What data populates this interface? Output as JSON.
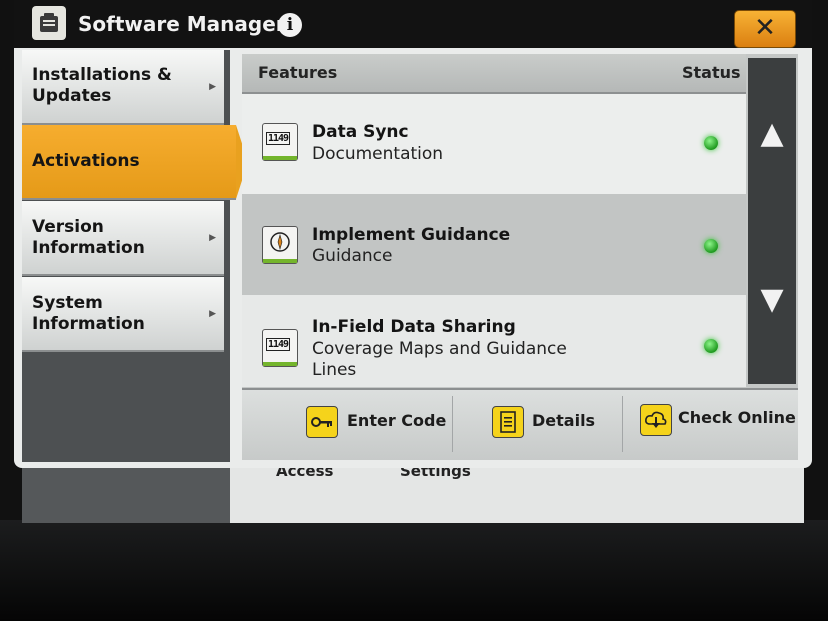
{
  "window": {
    "title": "Software Manager"
  },
  "sidebar": {
    "items": [
      {
        "label": "Installations & Updates",
        "active": false
      },
      {
        "label": "Activations",
        "active": true
      },
      {
        "label": "Version Information",
        "active": false
      },
      {
        "label": "System Information",
        "active": false
      }
    ]
  },
  "table": {
    "header_features": "Features",
    "header_status": "Status",
    "rows": [
      {
        "name": "Data Sync",
        "sub": "Documentation",
        "icon_text": "1149",
        "status": "active"
      },
      {
        "name": "Implement Guidance",
        "sub": "Guidance",
        "icon_text": "",
        "status": "active"
      },
      {
        "name": "In-Field Data Sharing",
        "sub": "Coverage Maps and Guidance Lines",
        "icon_text": "1149",
        "status": "active"
      }
    ]
  },
  "footer": {
    "enter_code": "Enter Code",
    "details": "Details",
    "check_online": "Check Online"
  },
  "background_screen": {
    "label_left": "Access",
    "label_right": "Settings"
  },
  "colors": {
    "accent_orange": "#e9a11f",
    "status_green": "#39c53a",
    "titlebar": "#121212",
    "button_yellow": "#f5d31b"
  },
  "icons": {
    "app": "software-manager-icon",
    "info": "info-icon",
    "close": "close-icon",
    "scroll_up": "arrow-up-icon",
    "scroll_down": "arrow-down-icon",
    "enter_code": "key-icon",
    "details": "document-icon",
    "check_online": "cloud-download-icon"
  }
}
